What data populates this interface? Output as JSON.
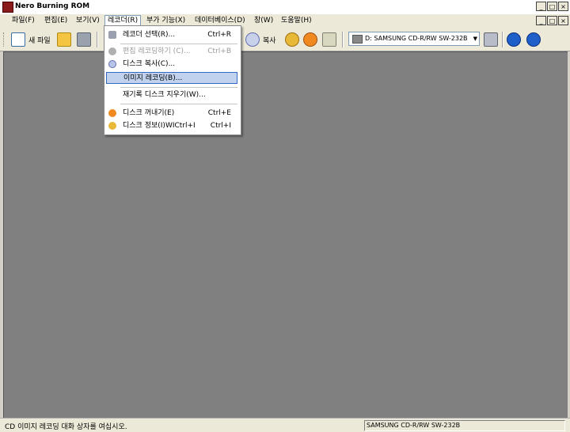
{
  "window": {
    "title": "Nero Burning ROM",
    "buttons": [
      "_",
      "□",
      "×"
    ]
  },
  "menubar": [
    {
      "label": "파일(F)"
    },
    {
      "label": "편집(E)"
    },
    {
      "label": "보기(V)"
    },
    {
      "label": "레코더(R)",
      "open": true
    },
    {
      "label": "부가 기능(X)"
    },
    {
      "label": "데이터베이스(D)"
    },
    {
      "label": "창(W)"
    },
    {
      "label": "도움말(H)"
    }
  ],
  "toolbar": {
    "new_label": "새 파일",
    "copy_label": "복사",
    "drive": "D: SAMSUNG CD-R/RW SW-232B"
  },
  "recorder_menu": [
    {
      "label": "레코더 선택(R)...",
      "shortcut": "Ctrl+R",
      "icon": "recorder-icon"
    },
    {
      "label": "편집 레코딩하기 (C)...",
      "shortcut": "Ctrl+B",
      "icon": "burn-icon",
      "disabled": true
    },
    {
      "label": "디스크 복사(C)...",
      "shortcut": "",
      "icon": "copy-disc-icon"
    },
    {
      "label": "이미지 레코딩(B)...",
      "shortcut": "",
      "icon": "",
      "highlighted": true
    },
    {
      "label": "재기록 디스크 지우기(W)...",
      "shortcut": "",
      "icon": ""
    },
    {
      "label": "디스크 꺼내기(E)",
      "shortcut": "Ctrl+E",
      "icon": "eject-icon"
    },
    {
      "label": "디스크 정보(I)WICtrl+I",
      "shortcut": "Ctrl+I",
      "icon": "info-icon"
    }
  ],
  "status": {
    "message": "CD 이미지 레코딩 대화 상자를 여십시오.",
    "drive": "SAMSUNG  CD-R/RW SW-232B"
  },
  "colors": {
    "workspace": "#808080",
    "highlight": "#c1d2ee",
    "highlight_border": "#316ac5"
  }
}
